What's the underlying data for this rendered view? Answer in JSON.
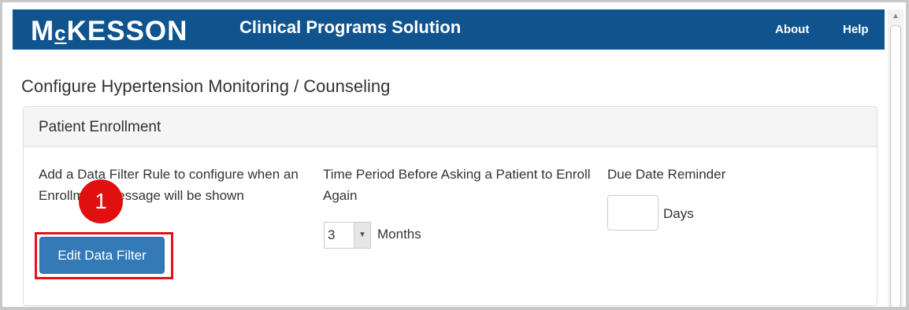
{
  "header": {
    "logo": "McKESSON",
    "logo_parts": {
      "main": "M",
      "small": "c",
      "rest": "KESSON"
    },
    "app_title": "Clinical Programs Solution",
    "nav": {
      "about": "About",
      "help": "Help"
    },
    "background_color": "#10548f"
  },
  "page": {
    "title": "Configure Hypertension Monitoring / Counseling"
  },
  "panel": {
    "heading": "Patient Enrollment",
    "data_filter": {
      "description": "Add a Data Filter Rule to configure when an Enrollment Message will be shown",
      "button_label": "Edit Data Filter"
    },
    "time_period": {
      "label": "Time Period Before Asking a Patient to Enroll Again",
      "selected_value": "3",
      "unit": "Months"
    },
    "due_date": {
      "label": "Due Date Reminder",
      "value": "",
      "unit": "Days"
    }
  },
  "annotation": {
    "callout_number": "1",
    "highlight_color": "#e0141b"
  }
}
